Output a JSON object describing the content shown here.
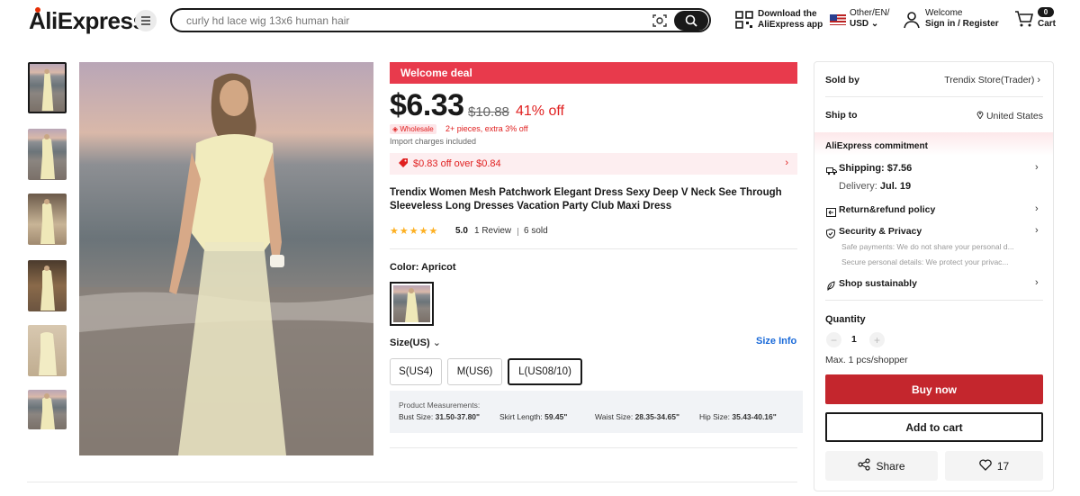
{
  "header": {
    "logo": "AliExpress",
    "search_placeholder": "curly hd lace wig 13x6 human hair",
    "app_line1": "Download the",
    "app_line2": "AliExpress app",
    "region_line1": "Other/EN/",
    "region_line2": "USD",
    "welcome": "Welcome",
    "signin": "Sign in / Register",
    "cart_count": "0",
    "cart_label": "Cart"
  },
  "product": {
    "deal_label": "Welcome deal",
    "price": "$6.33",
    "original_price": "$10.88",
    "discount": "41% off",
    "wholesale_badge": "Wholesale",
    "wholesale_text": "2+ pieces, extra 3% off",
    "import_text": "Import charges included",
    "coupon": "$0.83 off over $0.84",
    "title": "Trendix Women Mesh Patchwork Elegant Dress Sexy Deep V Neck See Through Sleeveless Long Dresses Vacation Party Club Maxi Dress",
    "stars": "★★★★★",
    "rating": "5.0",
    "reviews": "1 Review",
    "sold": "6 sold",
    "color_label": "Color: Apricot",
    "size_label": "Size(US)",
    "size_info": "Size Info",
    "sizes": [
      "S(US4)",
      "M(US6)",
      "L(US08/10)"
    ],
    "selected_size": "L(US08/10)",
    "measure_title": "Product Measurements:",
    "measures": [
      {
        "label": "Bust Size:",
        "value": "31.50-37.80\""
      },
      {
        "label": "Skirt Length:",
        "value": "59.45\""
      },
      {
        "label": "Waist Size:",
        "value": "28.35-34.65\""
      },
      {
        "label": "Hip Size:",
        "value": "35.43-40.16\""
      }
    ]
  },
  "seller": {
    "sold_by_label": "Sold by",
    "store": "Trendix Store(Trader)",
    "ship_to_label": "Ship to",
    "country": "United States",
    "commitment": "AliExpress commitment",
    "shipping": "Shipping: $7.56",
    "delivery_prefix": "Delivery:",
    "delivery_date": "Jul. 19",
    "return_policy": "Return&refund policy",
    "security": "Security & Privacy",
    "security_line1": "Safe payments: We do not share your personal d...",
    "security_line2": "Secure personal details: We protect your privac...",
    "sustainably": "Shop sustainably",
    "quantity_label": "Quantity",
    "quantity": "1",
    "max_text": "Max. 1 pcs/shopper",
    "buy_now": "Buy now",
    "add_to_cart": "Add to cart",
    "share": "Share",
    "wishlist_count": "17"
  },
  "colors": {
    "accent_red": "#e83a4c",
    "buy_red": "#c4262d",
    "price_red": "#e02020",
    "link_blue": "#1a6ad9",
    "star": "#fdb022"
  }
}
